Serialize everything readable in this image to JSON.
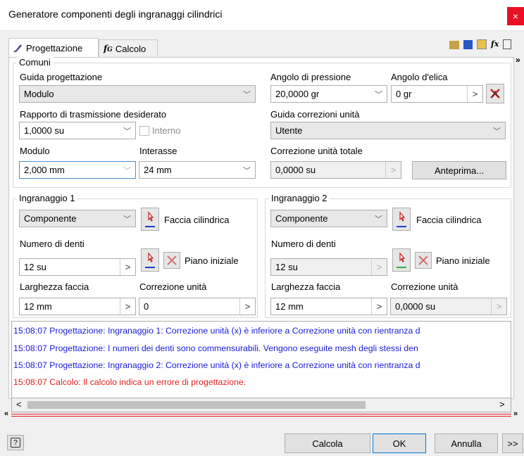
{
  "window": {
    "title": "Generatore componenti degli ingranaggi cilindrici",
    "close_glyph": "×"
  },
  "tabs": [
    {
      "label": "Progettazione",
      "icon": "design-pencil-icon"
    },
    {
      "label": "Calcolo",
      "icon": "fx-icon"
    }
  ],
  "toolbar_icons": [
    "folder-icon",
    "save-icon",
    "open-file-icon",
    "fx-icon",
    "document-icon"
  ],
  "common": {
    "group_label": "Comuni",
    "design_guide": {
      "label": "Guida progettazione",
      "value": "Modulo"
    },
    "pressure_angle": {
      "label": "Angolo di pressione",
      "value": "20,0000 gr"
    },
    "helix_angle": {
      "label": "Angolo d'elica",
      "value": "0 gr"
    },
    "gear_ratio": {
      "label": "Rapporto di trasmissione desiderato",
      "value": "1,0000 su"
    },
    "internal": {
      "label": "Interno",
      "checked": false
    },
    "unit_correction_guide": {
      "label": "Guida correzioni unità",
      "value": "Utente"
    },
    "module": {
      "label": "Modulo",
      "value": "2,000 mm"
    },
    "center_distance": {
      "label": "Interasse",
      "value": "24 mm"
    },
    "total_unit_correction": {
      "label": "Correzione unità totale",
      "value": "0,0000 su"
    },
    "preview_button": "Anteprima..."
  },
  "gear1": {
    "group_label": "Ingranaggio 1",
    "type": "Componente",
    "cylindrical_face": "Faccia cilindrica",
    "teeth_label": "Numero di denti",
    "teeth_value": "12 su",
    "start_plane": "Piano iniziale",
    "face_width_label": "Larghezza faccia",
    "face_width_value": "12 mm",
    "unit_correction_label": "Correzione unità",
    "unit_correction_value": "0"
  },
  "gear2": {
    "group_label": "Ingranaggio 2",
    "type": "Componente",
    "cylindrical_face": "Faccia cilindrica",
    "teeth_label": "Numero di denti",
    "teeth_value": "12 su",
    "start_plane": "Piano iniziale",
    "face_width_label": "Larghezza faccia",
    "face_width_value": "12 mm",
    "unit_correction_label": "Correzione unità",
    "unit_correction_value": "0,0000 su"
  },
  "log": [
    {
      "text": "15:08:07 Progettazione: Ingranaggio 1: Correzione unità (x) è inferiore a Correzione unità con rientranza d",
      "color": "#1a1adc"
    },
    {
      "text": "15:08:07 Progettazione: I numeri dei denti sono commensurabili. Vengono eseguite mesh degli stessi den",
      "color": "#1a1adc"
    },
    {
      "text": "15:08:07 Progettazione: Ingranaggio 2: Correzione unità (x) è inferiore a Correzione unità con rientranza d",
      "color": "#1a1adc"
    },
    {
      "text": "15:08:07 Calcolo: Il calcolo indica un errore di progettazione.",
      "color": "#e02020"
    }
  ],
  "footer": {
    "calc_button": "Calcola",
    "ok_button": "OK",
    "cancel_button": "Annulla",
    "more_button": ">>"
  },
  "glyphs": {
    "chevron_right": "»",
    "chevron_down": "﹀",
    "arrow_left": "<",
    "arrow_right": ">",
    "spin_arrow": ">",
    "double_up": "«",
    "help": "?"
  }
}
